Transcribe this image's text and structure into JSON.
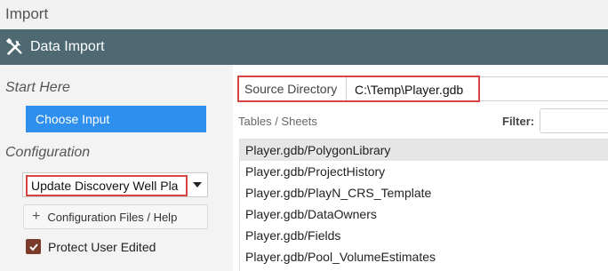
{
  "window": {
    "title": "Import"
  },
  "header": {
    "title": "Data Import",
    "icon": "tools-icon"
  },
  "sidebar": {
    "start_heading": "Start Here",
    "choose_input_label": "Choose Input",
    "configuration_heading": "Configuration",
    "configuration_selected": "Update Discovery Well Pla",
    "config_files_label": "Configuration Files / Help",
    "protect_label": "Protect User Edited",
    "protect_checked": true
  },
  "source": {
    "label": "Source Directory",
    "value": "C:\\Temp\\Player.gdb"
  },
  "tables": {
    "label": "Tables / Sheets",
    "filter_label": "Filter:",
    "filter_value": "",
    "items": [
      "Player.gdb/PolygonLibrary",
      "Player.gdb/ProjectHistory",
      "Player.gdb/PlayN_CRS_Template",
      "Player.gdb/DataOwners",
      "Player.gdb/Fields",
      "Player.gdb/Pool_VolumeEstimates"
    ],
    "selected_index": 0
  },
  "colors": {
    "header_bg": "#4f6973",
    "accent_blue": "#2f8fee",
    "highlight_red": "#d64541",
    "checkbox": "#7a3b2a"
  }
}
